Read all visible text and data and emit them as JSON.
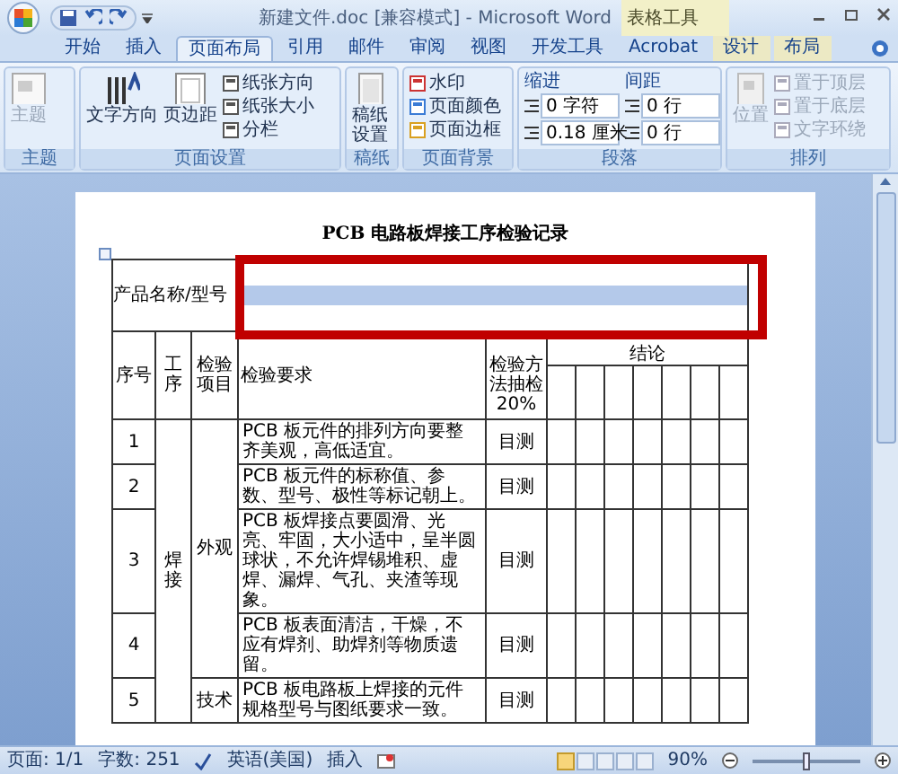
{
  "window": {
    "title": "新建文件.doc [兼容模式] - Microsoft Word",
    "context_group": "表格工具"
  },
  "tabs": [
    {
      "label": "开始",
      "selected": false,
      "contextual": false
    },
    {
      "label": "插入",
      "selected": false,
      "contextual": false
    },
    {
      "label": "页面布局",
      "selected": true,
      "contextual": false
    },
    {
      "label": "引用",
      "selected": false,
      "contextual": false
    },
    {
      "label": "邮件",
      "selected": false,
      "contextual": false
    },
    {
      "label": "审阅",
      "selected": false,
      "contextual": false
    },
    {
      "label": "视图",
      "selected": false,
      "contextual": false
    },
    {
      "label": "开发工具",
      "selected": false,
      "contextual": false
    },
    {
      "label": "Acrobat",
      "selected": false,
      "contextual": false
    },
    {
      "label": "设计",
      "selected": false,
      "contextual": true
    },
    {
      "label": "布局",
      "selected": false,
      "contextual": true
    }
  ],
  "ribbon": {
    "theme": {
      "label": "主题",
      "button": {
        "label": "主题",
        "disabled": true
      }
    },
    "page_setup": {
      "label": "页面设置",
      "big": [
        {
          "label": "文字方向"
        },
        {
          "label": "页边距"
        }
      ],
      "small": [
        {
          "label": "纸张方向"
        },
        {
          "label": "纸张大小"
        },
        {
          "label": "分栏"
        }
      ]
    },
    "manuscript": {
      "label": "稿纸",
      "button": {
        "label": "稿纸设置"
      }
    },
    "background": {
      "label": "页面背景",
      "small": [
        {
          "label": "水印"
        },
        {
          "label": "页面颜色"
        },
        {
          "label": "页面边框"
        }
      ]
    },
    "paragraph": {
      "label": "段落",
      "indent": {
        "label": "缩进",
        "values": [
          "0 字符",
          "0.18 厘米"
        ]
      },
      "spacing": {
        "label": "间距",
        "values": [
          "0 行",
          "0 行"
        ]
      }
    },
    "arrange": {
      "label": "排列",
      "button": {
        "label": "位置",
        "disabled": true
      },
      "small": [
        {
          "label": "置于顶层",
          "disabled": true
        },
        {
          "label": "置于底层",
          "disabled": true
        },
        {
          "label": "文字环绕",
          "disabled": true
        }
      ]
    }
  },
  "document": {
    "title": "PCB 电路板焊接工序检验记录",
    "product_label": "产品名称/型号",
    "product_value_selected": true,
    "headers": [
      "序号",
      "工序",
      "检验项目",
      "检验要求",
      "检验方法抽检20%",
      "结论"
    ],
    "processes": [
      {
        "label": "焊接",
        "items": [
          {
            "label": "外观",
            "rows": [
              {
                "no": "1",
                "requirement": "PCB 板元件的排列方向要整齐美观，高低适宜。",
                "method": "目测"
              },
              {
                "no": "2",
                "requirement": "PCB 板元件的标称值、参数、型号、极性等标记朝上。",
                "method": "目测"
              },
              {
                "no": "3",
                "requirement": "PCB 板焊接点要圆滑、光亮、牢固，大小适中，呈半圆球状，不允许焊锡堆积、虚焊、漏焊、气孔、夹渣等现象。",
                "method": "目测"
              },
              {
                "no": "4",
                "requirement": "PCB 板表面清洁，干燥，不应有焊剂、助焊剂等物质遗留。",
                "method": "目测"
              }
            ]
          },
          {
            "label": "技术",
            "rows": [
              {
                "no": "5",
                "requirement": "PCB 板电路板上焊接的元件规格型号与图纸要求一致。",
                "method": "目测"
              }
            ]
          }
        ]
      }
    ]
  },
  "status_bar": {
    "page": "页面: 1/1",
    "words": "字数: 251",
    "language": "英语(美国)",
    "mode": "插入",
    "views": [
      {
        "selected": true
      },
      {
        "selected": false
      },
      {
        "selected": false
      },
      {
        "selected": false
      },
      {
        "selected": false
      }
    ],
    "zoom": "90%",
    "zoom_slider": {
      "level": 0.5
    }
  }
}
